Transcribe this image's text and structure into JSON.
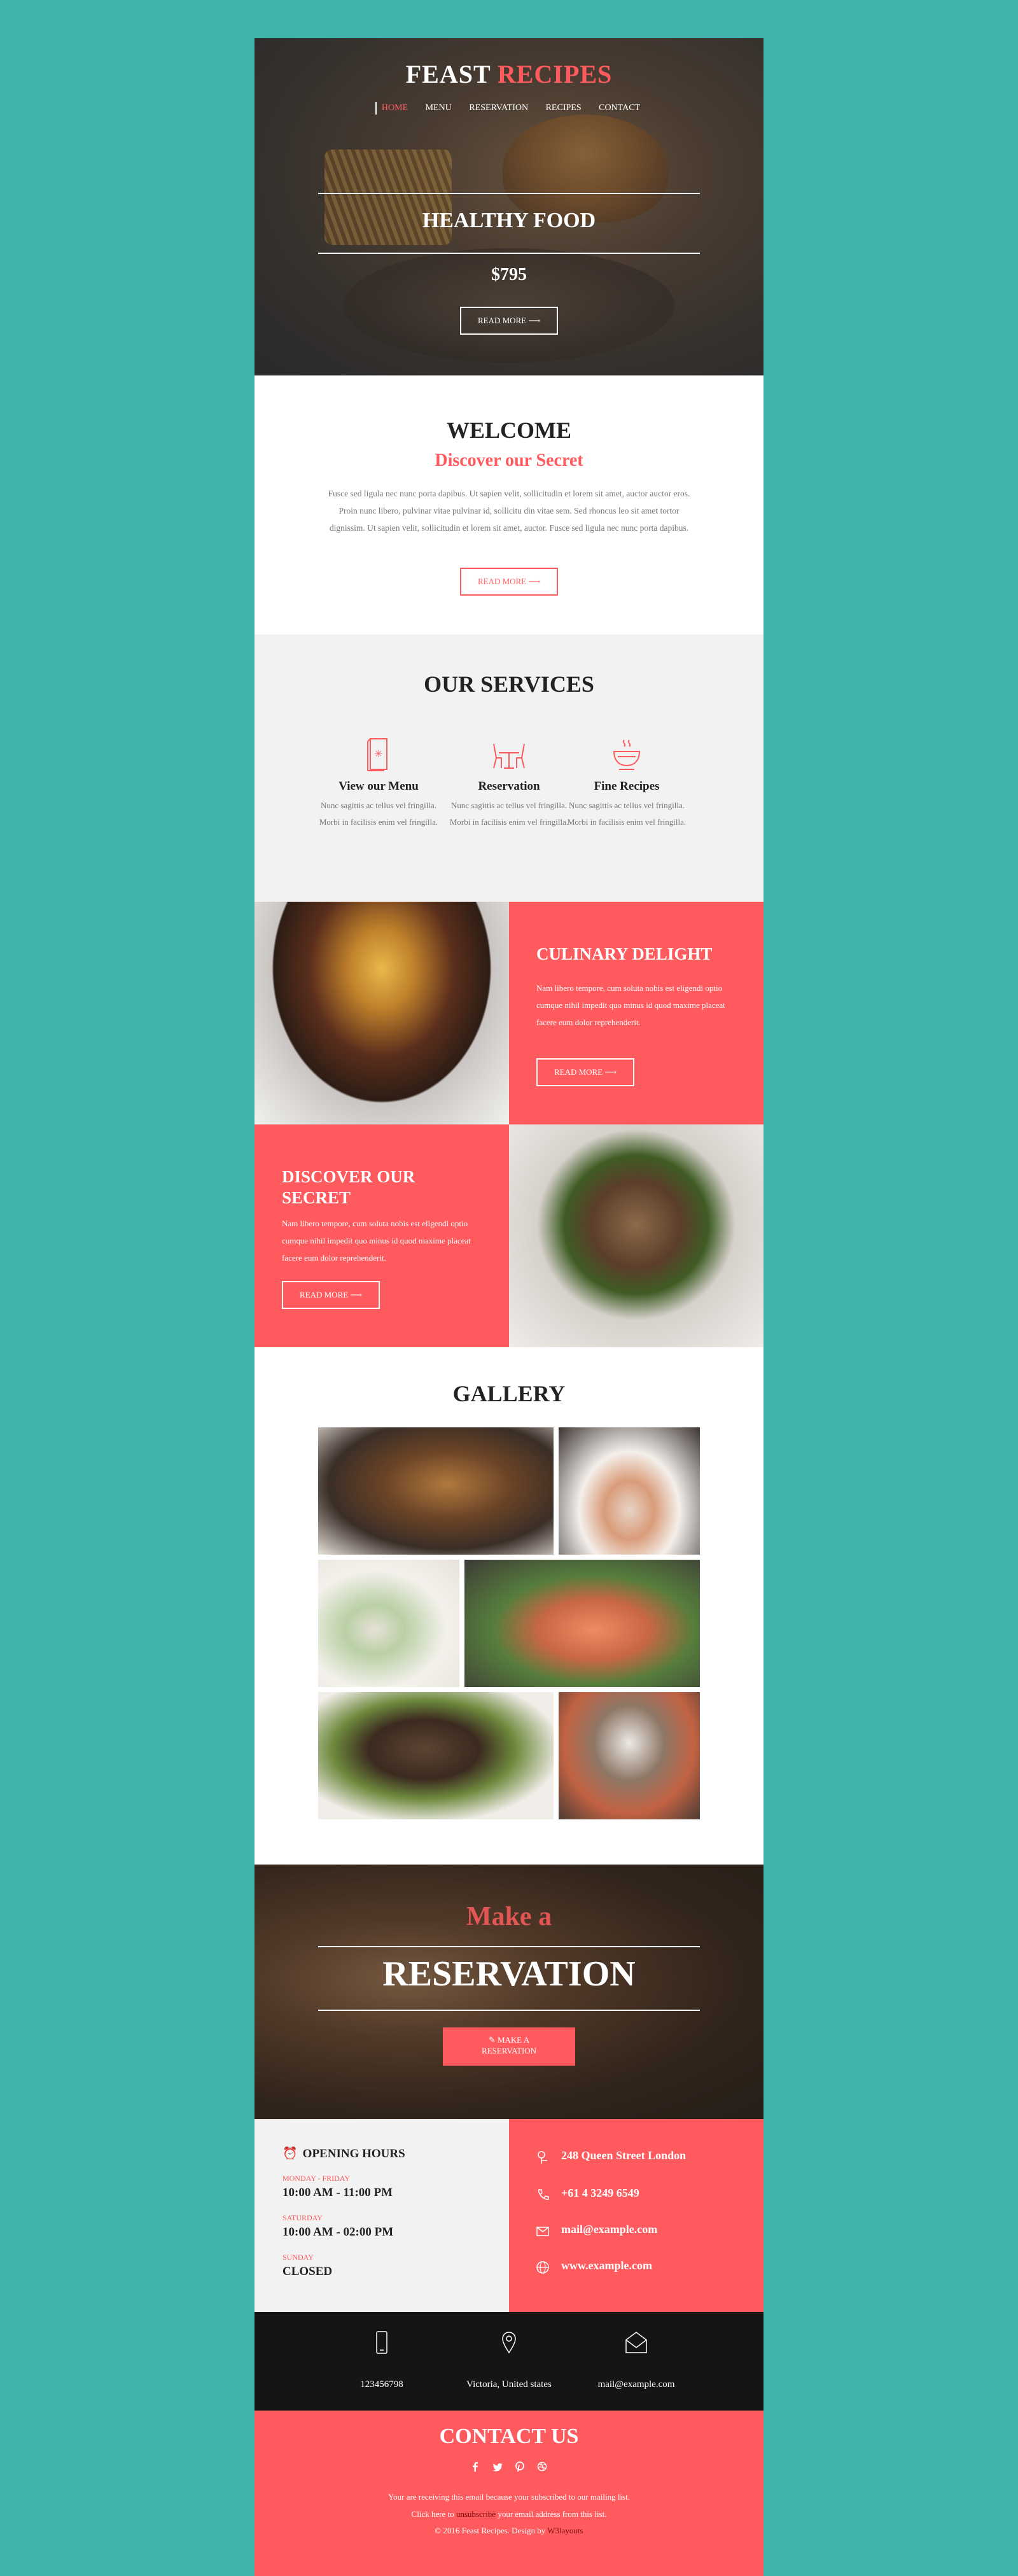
{
  "brand": {
    "name_part1": "FEAST",
    "name_part2": "RECIPES",
    "accent_color": "#ff5b5e",
    "page_bg": "#3fb2aa"
  },
  "nav": [
    "HOME",
    "MENU",
    "RESERVATION",
    "RECIPES",
    "CONTACT"
  ],
  "hero": {
    "title": "HEALTHY FOOD",
    "price": "$795",
    "button": "READ MORE"
  },
  "welcome": {
    "title": "WELCOME",
    "subtitle": "Discover our Secret",
    "body": "Fusce sed ligula nec nunc porta dapibus. Ut sapien velit, sollicitudin et lorem sit amet, auctor auctor eros. Proin nunc libero, pulvinar vitae pulvinar id, sollicitu din vitae sem. Sed rhoncus leo sit amet tortor dignissim. Ut sapien velit, sollicitudin et lorem sit amet, auctor. Fusce sed ligula nec nunc porta dapibus.",
    "button": "READ MORE"
  },
  "services": {
    "title": "OUR SERVICES",
    "items": [
      {
        "icon": "menu-book-icon",
        "title": "View our Menu",
        "text": "Nunc sagittis ac tellus vel fringilla. Morbi in facilisis enim vel fringilla."
      },
      {
        "icon": "table-chairs-icon",
        "title": "Reservation",
        "text": "Nunc sagittis ac tellus vel fringilla. Morbi in facilisis enim vel fringilla."
      },
      {
        "icon": "food-bowl-icon",
        "title": "Fine Recipes",
        "text": "Nunc sagittis ac tellus vel fringilla. Morbi in facilisis enim vel fringilla."
      }
    ]
  },
  "culinary": {
    "title": "CULINARY DELIGHT",
    "text": "Nam libero tempore, cum soluta nobis est eligendi optio cumque nihil impedit quo minus id quod maxime placeat facere eum dolor reprehenderit.",
    "button": "READ MORE"
  },
  "discover": {
    "title_line1": "DISCOVER OUR",
    "title_line2": "SECRET",
    "text": "Nam libero tempore, cum soluta nobis est eligendi optio cumque nihil impedit quo minus id quod maxime placeat facere eum dolor reprehenderit.",
    "button": "READ MORE"
  },
  "gallery": {
    "title": "GALLERY"
  },
  "reservation": {
    "overlay": "Make a",
    "title": "RESERVATION",
    "button_line1": "MAKE A",
    "button_line2": "RESERVATION"
  },
  "hours": {
    "title": "OPENING HOURS",
    "rows": [
      {
        "label": "MONDAY - FRIDAY",
        "value": "10:00 AM - 11:00 PM"
      },
      {
        "label": "SATURDAY",
        "value": "10:00 AM - 02:00 PM"
      },
      {
        "label": "SUNDAY",
        "value": "CLOSED"
      }
    ]
  },
  "contact_panel": {
    "address": "248 Queen Street London",
    "phone": "+61 4 3249 6549",
    "email": "mail@example.com",
    "web": "www.example.com"
  },
  "strip": {
    "phone": "123456798",
    "location": "Victoria, United states",
    "email": "mail@example.com"
  },
  "footer": {
    "title": "CONTACT US",
    "line1": "Your are receiving this email because your subscribed to our mailing list.",
    "line2_pre": "Click here to",
    "line2_link": "unsubscribe",
    "line2_post": "your email address from this list.",
    "line3_pre": "© 2016 Feast Recipes. Design by",
    "line3_link": "W3layouts"
  }
}
